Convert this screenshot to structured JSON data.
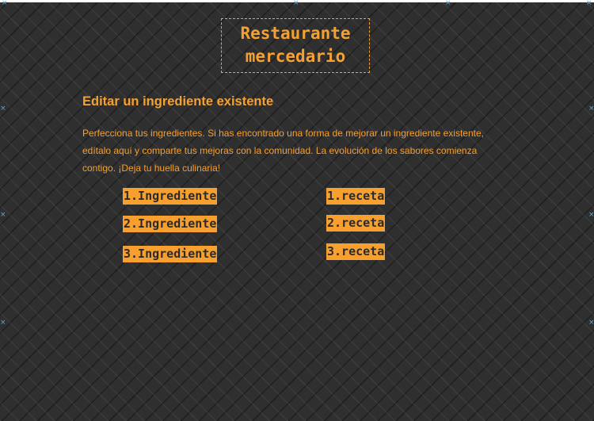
{
  "site": {
    "logo_line1": "Restaurante",
    "logo_line2": "mercedario"
  },
  "section": {
    "title": "Editar un ingrediente existente",
    "description": "Perfecciona tus ingredientes. Si has encontrado una forma de mejorar un ingrediente existente, edítalo aquí y comparte tus mejoras con la comunidad. La evolución de los sabores comienza contigo. ¡Deja tu huella culinaria!"
  },
  "ingredients": [
    {
      "label": "1.Ingrediente"
    },
    {
      "label": "2.Ingrediente"
    },
    {
      "label": "3.Ingrediente"
    }
  ],
  "recipes": [
    {
      "label": "1.receta"
    },
    {
      "label": "2.receta"
    },
    {
      "label": "3.receta"
    }
  ],
  "colors": {
    "accent": "#f5a033",
    "background": "#2f2f2f",
    "marker": "#5aa9d6"
  }
}
